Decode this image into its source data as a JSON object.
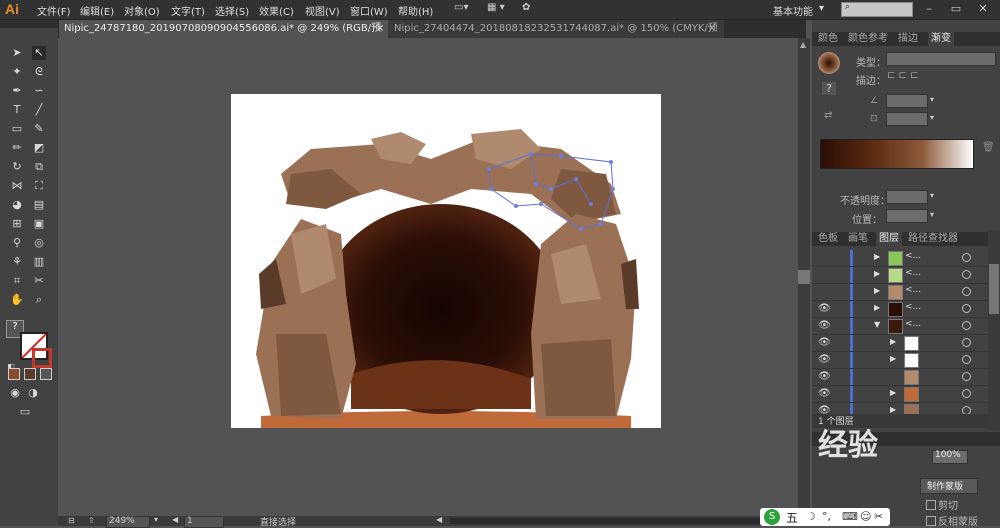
{
  "app": {
    "logo": "Ai",
    "workspace": "基本功能"
  },
  "menu": [
    "文件(F)",
    "编辑(E)",
    "对象(O)",
    "文字(T)",
    "选择(S)",
    "效果(C)",
    "视图(V)",
    "窗口(W)",
    "帮助(H)"
  ],
  "tabs": [
    {
      "label": "Nipic_24787180_20190708090904556086.ai* @ 249% (RGB/预览)",
      "active": true
    },
    {
      "label": "Nipic_27404474_20180818232531744087.ai* @ 150% (CMYK/预览)",
      "active": false
    }
  ],
  "gradient_panel": {
    "tabs": [
      "颜色",
      "颜色参考",
      "描边",
      "渐变"
    ],
    "type_label": "类型：",
    "stroke_label": "描边：",
    "opacity_label": "不透明度：",
    "position_label": "位置：",
    "gradient_colors": [
      "#2a0e05",
      "#5a2a12",
      "#8c5a3a",
      "#ffffff"
    ]
  },
  "layers_panel": {
    "tabs": [
      "色板",
      "画笔",
      "图层",
      "路径查找器"
    ],
    "rows": [
      {
        "name": "<...",
        "visible": false,
        "expanded": false
      },
      {
        "name": "<...",
        "visible": false,
        "expanded": false
      },
      {
        "name": "<...",
        "visible": false,
        "expanded": false
      },
      {
        "name": "<...",
        "visible": true,
        "expanded": false
      },
      {
        "name": "<...",
        "visible": true,
        "expanded": true
      },
      {
        "name": "",
        "visible": true,
        "expanded": false
      },
      {
        "name": "",
        "visible": true,
        "expanded": false
      },
      {
        "name": "",
        "visible": true,
        "expanded": false
      },
      {
        "name": "",
        "visible": true,
        "expanded": false
      },
      {
        "name": "",
        "visible": true,
        "expanded": false
      }
    ],
    "footer": "1 个图层"
  },
  "transparency_panel": {
    "opacity_value": "100%",
    "make_mask_button": "制作蒙版",
    "clip_label": "剪切",
    "invert_label": "反相蒙版"
  },
  "status": {
    "zoom": "249%",
    "page": "1",
    "tool_name": "直接选择"
  },
  "watermark": "经验",
  "taskbar_ime": "五"
}
